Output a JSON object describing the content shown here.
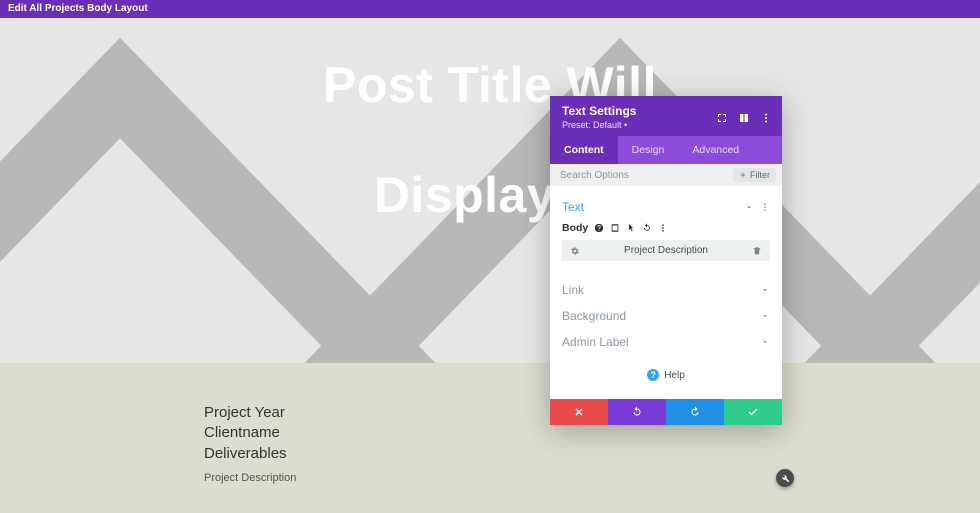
{
  "topbar": {
    "title": "Edit All Projects Body Layout"
  },
  "hero": {
    "line1": "Post Title Will",
    "line2": "Display H"
  },
  "meta": {
    "year": "Project Year",
    "client": "Clientname",
    "deliverables": "Deliverables",
    "desc": "Project Description"
  },
  "modal": {
    "title": "Text Settings",
    "preset": "Preset: Default •",
    "tabs": {
      "content": "Content",
      "design": "Design",
      "advanced": "Advanced"
    },
    "search_placeholder": "Search Options",
    "filter": "Filter",
    "sections": {
      "text": "Text",
      "link": "Link",
      "background": "Background",
      "admin": "Admin Label"
    },
    "body_label": "Body",
    "desc_bar": "Project Description",
    "help": "Help"
  }
}
